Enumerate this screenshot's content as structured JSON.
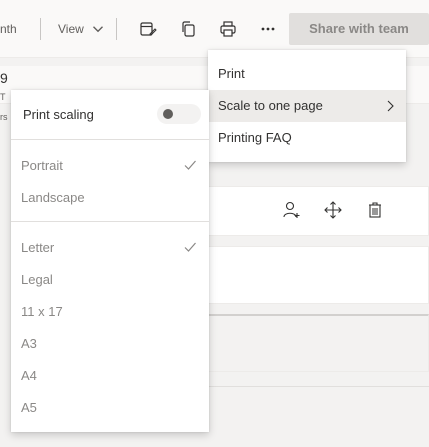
{
  "toolbar": {
    "month_label": "nth",
    "view_label": "View",
    "share_label": "Share with team",
    "icons": [
      "calendar-edit-icon",
      "copy-icon",
      "printer-icon",
      "more-icon",
      "chevron-down-icon"
    ]
  },
  "background": {
    "day_number": "9",
    "day_abbrev": "T",
    "hours_text": "rs"
  },
  "print_menu": {
    "items": [
      {
        "label": "Print"
      },
      {
        "label": "Scale to one page"
      },
      {
        "label": "Printing FAQ"
      }
    ]
  },
  "scale_menu": {
    "toggle_label": "Print scaling",
    "toggle_on": false,
    "orientation": [
      {
        "label": "Portrait",
        "checked": true
      },
      {
        "label": "Landscape",
        "checked": false
      }
    ],
    "paper": [
      {
        "label": "Letter",
        "checked": true
      },
      {
        "label": "Legal",
        "checked": false
      },
      {
        "label": "11 x 17",
        "checked": false
      },
      {
        "label": "A3",
        "checked": false
      },
      {
        "label": "A4",
        "checked": false
      },
      {
        "label": "A5",
        "checked": false
      }
    ]
  },
  "colors": {
    "toolbar_bg": "#faf9f8",
    "menu_hover": "#edebe9",
    "disabled_text": "#8a8886",
    "share_bg": "#e1dfdd"
  }
}
